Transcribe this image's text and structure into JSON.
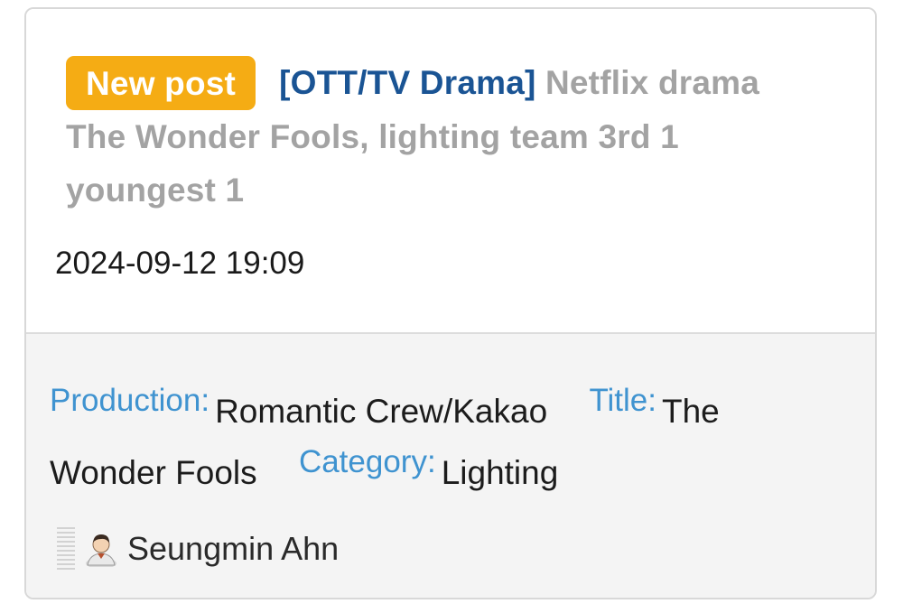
{
  "post": {
    "badge": "New post",
    "category": "[OTT/TV Drama]",
    "title": "Netflix drama The Wonder Fools, lighting team 3rd 1 youngest 1",
    "timestamp": "2024-09-12 19:09"
  },
  "details": {
    "production_label": "Production:",
    "production_value": "Romantic Crew/Kakao",
    "title_label": "Title:",
    "title_value": "The Wonder Fools",
    "category_label": "Category:",
    "category_value": "Lighting"
  },
  "author": {
    "name": "Seungmin Ahn",
    "avatar_icon": "user-avatar-icon"
  },
  "colors": {
    "badge": "#f5ac14",
    "category": "#1a5494",
    "title": "#a3a3a3",
    "label": "#3f93d0"
  }
}
